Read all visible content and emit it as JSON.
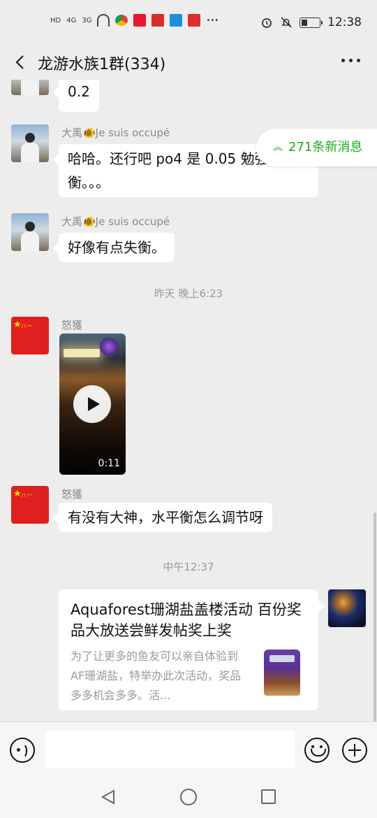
{
  "status_bar": {
    "left_indicators": [
      "HD",
      "4G",
      "3G"
    ],
    "time": "12:38",
    "colors": {
      "weibo": "#e6162d",
      "alert": "#d62c2c",
      "message": "#1e8fe0",
      "app": "#e02e2e"
    }
  },
  "header": {
    "title": "龙游水族1群(334)"
  },
  "new_messages": {
    "label": "271条新消息"
  },
  "messages": [
    {
      "text": "0.2"
    },
    {
      "sender": "大禹🐠Je suis occupé",
      "text": "哈哈。还行吧 po4 是 0.05 勉强接受 衡。。。"
    },
    {
      "sender": "大禹🐠Je suis occupé",
      "text": "好像有点失衡。"
    },
    {
      "sender": "怒獲",
      "type": "video",
      "duration": "0:11"
    },
    {
      "sender": "怒獲",
      "text": "有没有大神，水平衡怎么调节呀"
    }
  ],
  "timestamps": [
    "昨天 晚上6:23",
    "中午12:37"
  ],
  "link_card": {
    "title": "Aquaforest珊湖盐盖楼活动 百份奖品大放送尝鲜发帖奖上奖",
    "description": "为了让更多的鱼友可以亲自体验到AF珊湖盐，特举办此次活动，奖品多多机会多多。活..."
  },
  "avatar_flag_text": "八一",
  "colors": {
    "accent": "#1aad19",
    "background": "#ededed"
  }
}
